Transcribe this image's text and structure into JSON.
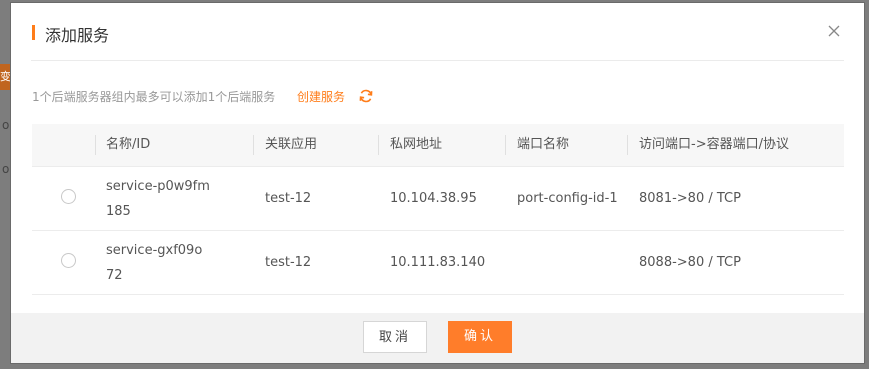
{
  "backdrop": {
    "tag_text": "变",
    "text1": "ou",
    "text2": "ou"
  },
  "dialog": {
    "title": "添加服务",
    "hint": "1个后端服务器组内最多可以添加1个后端服务",
    "create_link": "创建服务",
    "columns": [
      "名称/ID",
      "关联应用",
      "私网地址",
      "端口名称",
      "访问端口->容器端口/协议"
    ],
    "rows": [
      {
        "name_line1": "service-p0w9fm",
        "name_line2": "185",
        "app": "test-12",
        "ip": "10.104.38.95",
        "port_name": "port-config-id-1",
        "ports": "8081->80 / TCP"
      },
      {
        "name_line1": "service-gxf09o",
        "name_line2": "72",
        "app": "test-12",
        "ip": "10.111.83.140",
        "port_name": "",
        "ports": "8088->80 / TCP"
      }
    ],
    "buttons": {
      "cancel": "取消",
      "ok": "确认"
    },
    "colors": {
      "accent": "#ff7d1a",
      "footer_bg": "#f2f2f2",
      "header_bg": "#f7f7f7"
    }
  }
}
